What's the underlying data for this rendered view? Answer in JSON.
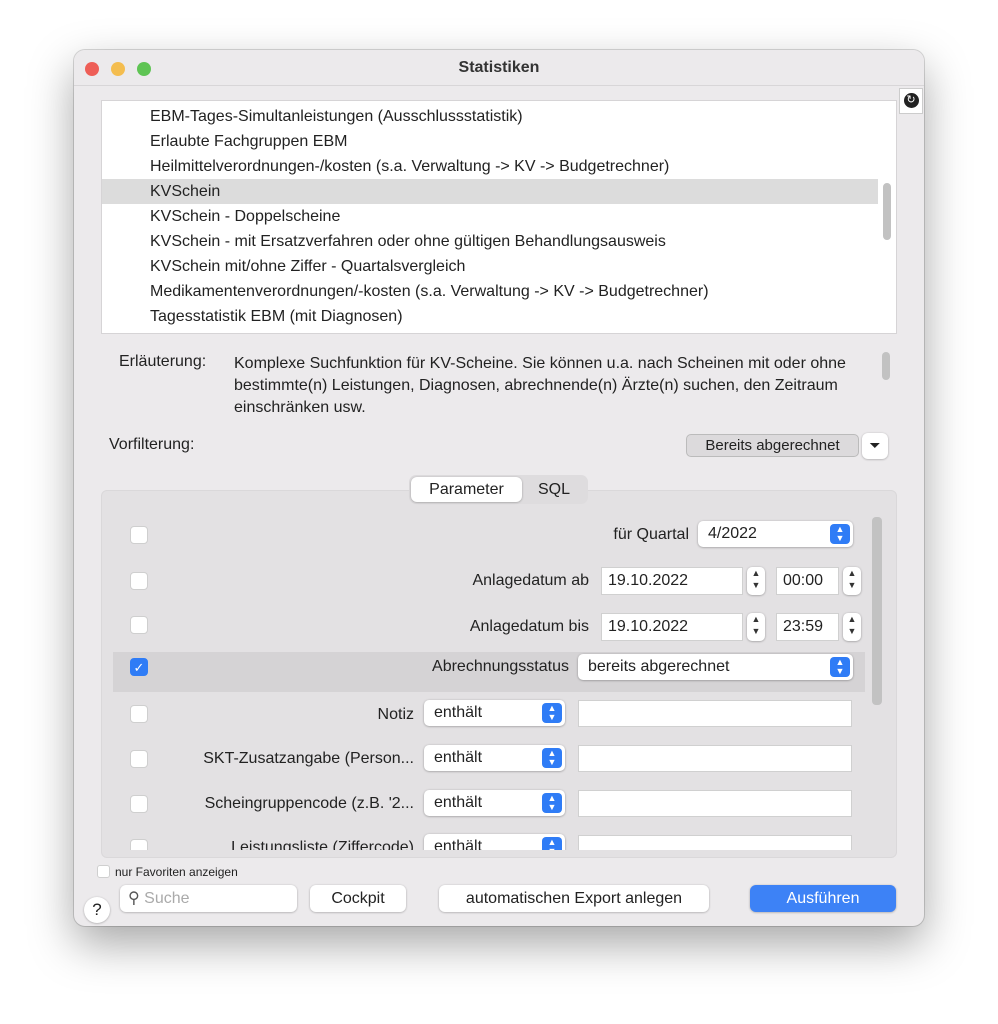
{
  "window": {
    "title": "Statistiken"
  },
  "statistics_list": {
    "items": [
      "EBM-Tages-Simultanleistungen (Ausschlussstatistik)",
      "Erlaubte Fachgruppen EBM",
      "Heilmittelverordnungen-/kosten (s.a. Verwaltung -> KV -> Budgetrechner)",
      "KVSchein",
      "KVSchein - Doppelscheine",
      "KVSchein - mit Ersatzverfahren oder ohne gültigen Behandlungsausweis",
      "KVSchein mit/ohne Ziffer - Quartalsvergleich",
      "Medikamentenverordnungen/-kosten (s.a. Verwaltung -> KV -> Budgetrechner)",
      "Tagesstatistik EBM (mit Diagnosen)"
    ],
    "selected": "KVSchein"
  },
  "explanation": {
    "label": "Erläuterung:",
    "text": "Komplexe Suchfunktion für KV-Scheine. Sie können u.a. nach Scheinen mit oder ohne bestimmte(n) Leistungen, Diagnosen, abrechnende(n) Ärzte(n) suchen, den Zeitraum einschränken usw."
  },
  "prefilter": {
    "label": "Vorfilterung:",
    "button": "Bereits abgerechnet"
  },
  "tabs": {
    "parameter": "Parameter",
    "sql": "SQL",
    "active": "Parameter"
  },
  "params": {
    "quartal": {
      "label": "für Quartal",
      "value": "4/2022",
      "checked": false
    },
    "from": {
      "label": "Anlagedatum ab",
      "date": "19.10.2022",
      "time": "00:00",
      "checked": false
    },
    "to": {
      "label": "Anlagedatum bis",
      "date": "19.10.2022",
      "time": "23:59",
      "checked": false
    },
    "status": {
      "label": "Abrechnungsstatus",
      "value": "bereits abgerechnet",
      "checked": true
    },
    "notiz": {
      "label": "Notiz",
      "op": "enthält",
      "value": "",
      "checked": false
    },
    "skt": {
      "label": "SKT-Zusatzangabe (Person...",
      "op": "enthält",
      "value": "",
      "checked": false
    },
    "sgc": {
      "label": "Scheingruppencode (z.B. '2...",
      "op": "enthält",
      "value": "",
      "checked": false
    },
    "ll": {
      "label": "Leistungsliste (Ziffercode)",
      "op": "enthält",
      "value": "",
      "checked": false
    }
  },
  "footer": {
    "favorites": "nur Favoriten anzeigen",
    "search_placeholder": "Suche",
    "cockpit": "Cockpit",
    "export": "automatischen Export anlegen",
    "run": "Ausführen",
    "help": "?"
  },
  "colors": {
    "accent": "#2F7CF6",
    "run_button": "#3D82F6"
  }
}
